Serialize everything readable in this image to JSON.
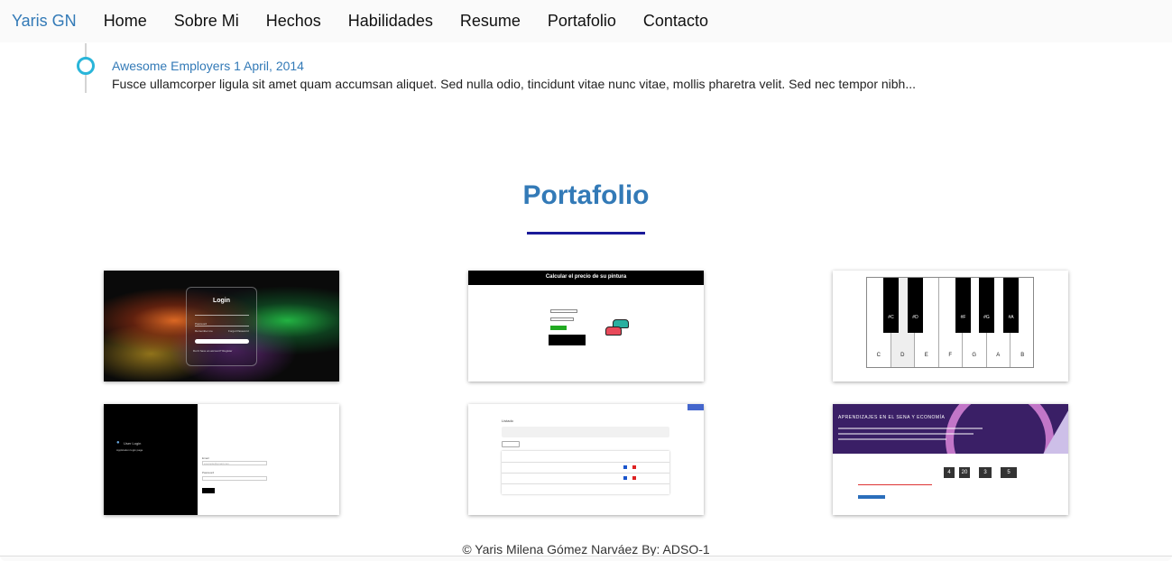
{
  "navbar": {
    "brand": "Yaris GN",
    "links": [
      "Home",
      "Sobre Mi",
      "Hechos",
      "Habilidades",
      "Resume",
      "Portafolio",
      "Contacto"
    ]
  },
  "timeline": {
    "title": "Awesome Employers 1 April, 2014",
    "text": "Fusce ullamcorper ligula sit amet quam accumsan aliquet. Sed nulla odio, tincidunt vitae nunc vitae, mollis pharetra velit. Sed nec tempor nibh..."
  },
  "portfolio": {
    "title": "Portafolio",
    "accent_color": "#1a1a99",
    "items": [
      {
        "login_title": "Login",
        "password_label": "Password",
        "remember_label": "Remember me",
        "forgot_label": "Forgot Password",
        "register_text": "Don't have an account? Register"
      },
      {
        "header": "Calcular el precio de su pintura"
      },
      {
        "black_keys": [
          "#C",
          "#D",
          "#F",
          "#G",
          "#A"
        ],
        "white_keys": [
          "C",
          "D",
          "E",
          "F",
          "G",
          "A",
          "B"
        ]
      },
      {
        "heading": "User Login",
        "subheading": "Application login page",
        "email_label": "Email",
        "email_placeholder": "example@gmail.com",
        "password_label": "Password"
      },
      {
        "heading": "Listado"
      },
      {
        "header": "APRENDIZAJES EN EL SENA Y ECONOMÍA",
        "countdown": [
          "4",
          "20",
          "3",
          "5"
        ]
      }
    ]
  },
  "footer": {
    "text": "© Yaris Milena Gómez Narváez By: ADSO-1"
  }
}
